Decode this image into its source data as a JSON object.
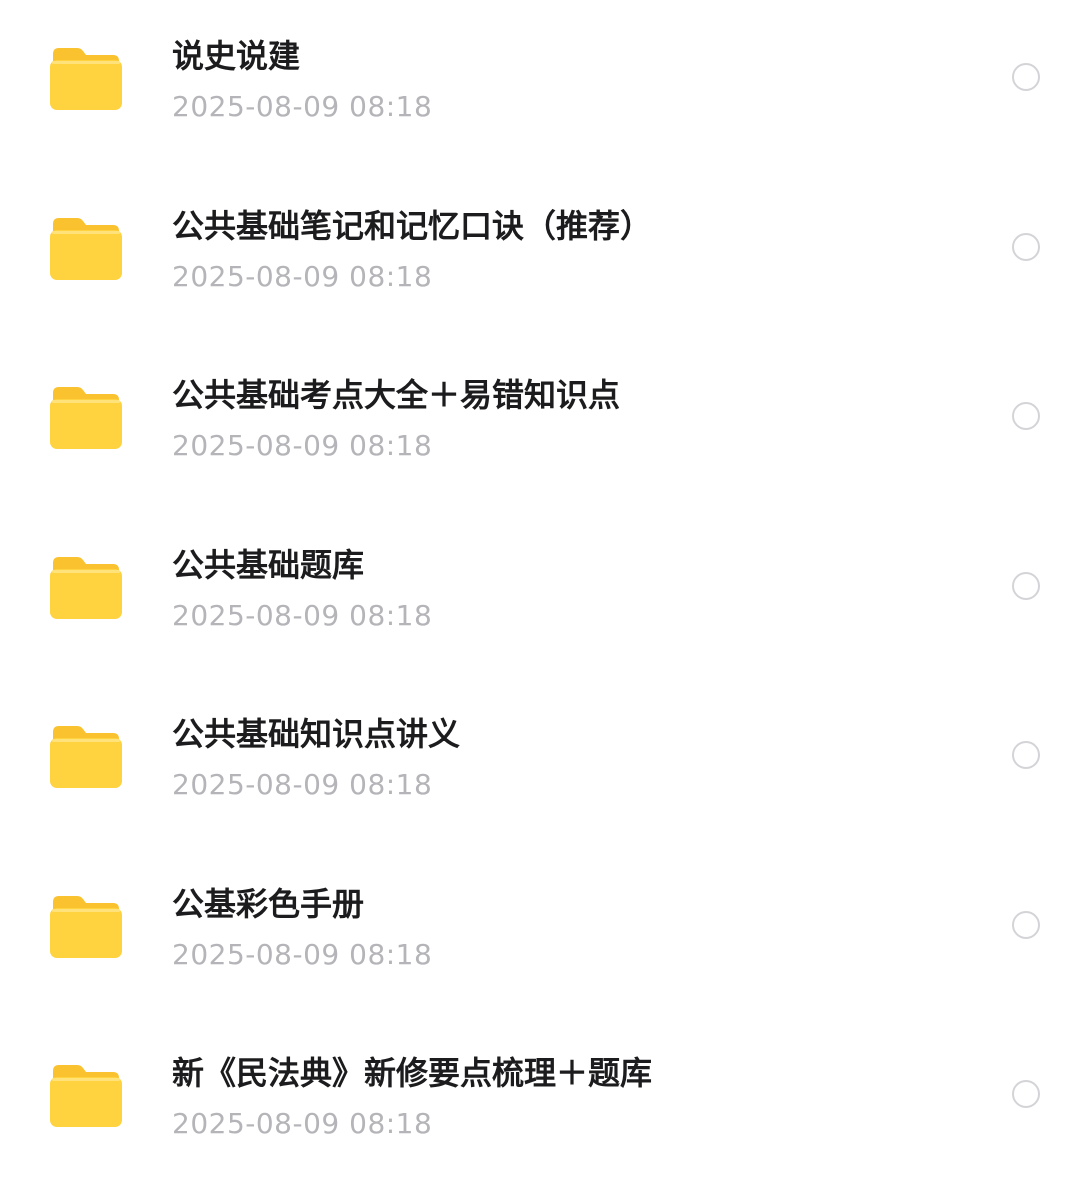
{
  "colors": {
    "folder_body": "#FFD23F",
    "folder_tab": "#F9C22E",
    "name_text": "#1C1C1E",
    "time_text": "#B5B5B9",
    "check_border": "#D4D4D8"
  },
  "items": [
    {
      "name": "说史说建",
      "time": "2025-08-09 08:18",
      "icon": "folder-icon",
      "selected": false
    },
    {
      "name": "公共基础笔记和记忆口诀（推荐）",
      "time": "2025-08-09 08:18",
      "icon": "folder-icon",
      "selected": false
    },
    {
      "name": "公共基础考点大全＋易错知识点",
      "time": "2025-08-09 08:18",
      "icon": "folder-icon",
      "selected": false
    },
    {
      "name": "公共基础题库",
      "time": "2025-08-09 08:18",
      "icon": "folder-icon",
      "selected": false
    },
    {
      "name": "公共基础知识点讲义",
      "time": "2025-08-09 08:18",
      "icon": "folder-icon",
      "selected": false
    },
    {
      "name": "公基彩色手册",
      "time": "2025-08-09 08:18",
      "icon": "folder-icon",
      "selected": false
    },
    {
      "name": "新《民法典》新修要点梳理＋题库",
      "time": "2025-08-09 08:18",
      "icon": "folder-icon",
      "selected": false
    }
  ]
}
